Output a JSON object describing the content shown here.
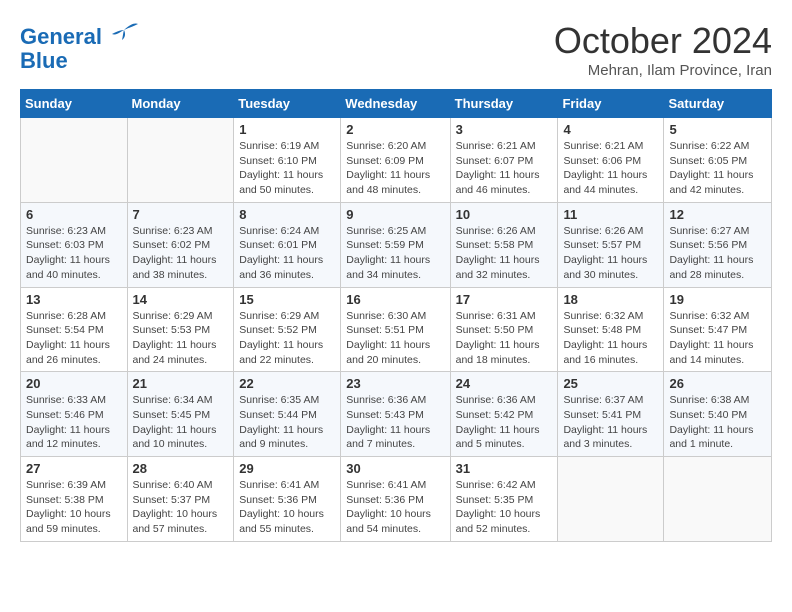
{
  "logo": {
    "line1": "General",
    "line2": "Blue"
  },
  "title": "October 2024",
  "location": "Mehran, Ilam Province, Iran",
  "days_of_week": [
    "Sunday",
    "Monday",
    "Tuesday",
    "Wednesday",
    "Thursday",
    "Friday",
    "Saturday"
  ],
  "weeks": [
    [
      {
        "day": null
      },
      {
        "day": null
      },
      {
        "day": 1,
        "sunrise": "6:19 AM",
        "sunset": "6:10 PM",
        "daylight": "11 hours and 50 minutes."
      },
      {
        "day": 2,
        "sunrise": "6:20 AM",
        "sunset": "6:09 PM",
        "daylight": "11 hours and 48 minutes."
      },
      {
        "day": 3,
        "sunrise": "6:21 AM",
        "sunset": "6:07 PM",
        "daylight": "11 hours and 46 minutes."
      },
      {
        "day": 4,
        "sunrise": "6:21 AM",
        "sunset": "6:06 PM",
        "daylight": "11 hours and 44 minutes."
      },
      {
        "day": 5,
        "sunrise": "6:22 AM",
        "sunset": "6:05 PM",
        "daylight": "11 hours and 42 minutes."
      }
    ],
    [
      {
        "day": 6,
        "sunrise": "6:23 AM",
        "sunset": "6:03 PM",
        "daylight": "11 hours and 40 minutes."
      },
      {
        "day": 7,
        "sunrise": "6:23 AM",
        "sunset": "6:02 PM",
        "daylight": "11 hours and 38 minutes."
      },
      {
        "day": 8,
        "sunrise": "6:24 AM",
        "sunset": "6:01 PM",
        "daylight": "11 hours and 36 minutes."
      },
      {
        "day": 9,
        "sunrise": "6:25 AM",
        "sunset": "5:59 PM",
        "daylight": "11 hours and 34 minutes."
      },
      {
        "day": 10,
        "sunrise": "6:26 AM",
        "sunset": "5:58 PM",
        "daylight": "11 hours and 32 minutes."
      },
      {
        "day": 11,
        "sunrise": "6:26 AM",
        "sunset": "5:57 PM",
        "daylight": "11 hours and 30 minutes."
      },
      {
        "day": 12,
        "sunrise": "6:27 AM",
        "sunset": "5:56 PM",
        "daylight": "11 hours and 28 minutes."
      }
    ],
    [
      {
        "day": 13,
        "sunrise": "6:28 AM",
        "sunset": "5:54 PM",
        "daylight": "11 hours and 26 minutes."
      },
      {
        "day": 14,
        "sunrise": "6:29 AM",
        "sunset": "5:53 PM",
        "daylight": "11 hours and 24 minutes."
      },
      {
        "day": 15,
        "sunrise": "6:29 AM",
        "sunset": "5:52 PM",
        "daylight": "11 hours and 22 minutes."
      },
      {
        "day": 16,
        "sunrise": "6:30 AM",
        "sunset": "5:51 PM",
        "daylight": "11 hours and 20 minutes."
      },
      {
        "day": 17,
        "sunrise": "6:31 AM",
        "sunset": "5:50 PM",
        "daylight": "11 hours and 18 minutes."
      },
      {
        "day": 18,
        "sunrise": "6:32 AM",
        "sunset": "5:48 PM",
        "daylight": "11 hours and 16 minutes."
      },
      {
        "day": 19,
        "sunrise": "6:32 AM",
        "sunset": "5:47 PM",
        "daylight": "11 hours and 14 minutes."
      }
    ],
    [
      {
        "day": 20,
        "sunrise": "6:33 AM",
        "sunset": "5:46 PM",
        "daylight": "11 hours and 12 minutes."
      },
      {
        "day": 21,
        "sunrise": "6:34 AM",
        "sunset": "5:45 PM",
        "daylight": "11 hours and 10 minutes."
      },
      {
        "day": 22,
        "sunrise": "6:35 AM",
        "sunset": "5:44 PM",
        "daylight": "11 hours and 9 minutes."
      },
      {
        "day": 23,
        "sunrise": "6:36 AM",
        "sunset": "5:43 PM",
        "daylight": "11 hours and 7 minutes."
      },
      {
        "day": 24,
        "sunrise": "6:36 AM",
        "sunset": "5:42 PM",
        "daylight": "11 hours and 5 minutes."
      },
      {
        "day": 25,
        "sunrise": "6:37 AM",
        "sunset": "5:41 PM",
        "daylight": "11 hours and 3 minutes."
      },
      {
        "day": 26,
        "sunrise": "6:38 AM",
        "sunset": "5:40 PM",
        "daylight": "11 hours and 1 minute."
      }
    ],
    [
      {
        "day": 27,
        "sunrise": "6:39 AM",
        "sunset": "5:38 PM",
        "daylight": "10 hours and 59 minutes."
      },
      {
        "day": 28,
        "sunrise": "6:40 AM",
        "sunset": "5:37 PM",
        "daylight": "10 hours and 57 minutes."
      },
      {
        "day": 29,
        "sunrise": "6:41 AM",
        "sunset": "5:36 PM",
        "daylight": "10 hours and 55 minutes."
      },
      {
        "day": 30,
        "sunrise": "6:41 AM",
        "sunset": "5:36 PM",
        "daylight": "10 hours and 54 minutes."
      },
      {
        "day": 31,
        "sunrise": "6:42 AM",
        "sunset": "5:35 PM",
        "daylight": "10 hours and 52 minutes."
      },
      {
        "day": null
      },
      {
        "day": null
      }
    ]
  ]
}
